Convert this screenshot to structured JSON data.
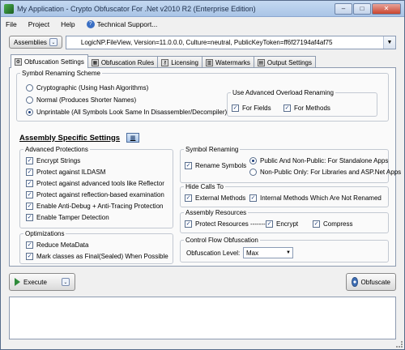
{
  "window": {
    "title": "My Application - Crypto Obfuscator For .Net v2010 R2 (Enterprise Edition)",
    "min": "–",
    "max": "□",
    "close": "✕"
  },
  "menu": {
    "file": "File",
    "project": "Project",
    "help": "Help",
    "support": "Technical Support..."
  },
  "assemblies": {
    "button_label": "Assemblies",
    "selected": "LogicNP.FileView, Version=11.0.0.0, Culture=neutral, PublicKeyToken=ff6f27194af4af75"
  },
  "tabs": [
    {
      "label": "Obfuscation Settings",
      "active": true
    },
    {
      "label": "Obfuscation Rules",
      "active": false
    },
    {
      "label": "Licensing",
      "active": false
    },
    {
      "label": "Watermarks",
      "active": false
    },
    {
      "label": "Output Settings",
      "active": false
    }
  ],
  "symbol_renaming_scheme": {
    "title": "Symbol Renaming Scheme",
    "options": [
      {
        "label": "Cryptographic (Using Hash Algorithms)",
        "checked": false
      },
      {
        "label": "Normal (Produces Shorter Names)",
        "checked": false
      },
      {
        "label": "Unprintable  (All Symbols Look Same In Disassembler/Decompiler)",
        "checked": true
      }
    ],
    "overload": {
      "title": "Use Advanced Overload Renaming",
      "for_fields": "For Fields",
      "for_methods": "For Methods"
    }
  },
  "assembly_specific": {
    "title": "Assembly Specific Settings"
  },
  "advanced_protections": {
    "title": "Advanced Protections",
    "items": [
      "Encrypt Strings",
      "Protect against ILDASM",
      "Protect against advanced tools like Reflector",
      "Protect against reflection-based examination",
      "Enable Anti-Debug + Anti-Tracing Protection",
      "Enable Tamper Detection"
    ]
  },
  "optimizations": {
    "title": "Optimizations",
    "items": [
      "Reduce MetaData",
      "Mark classes as Final(Sealed) When Possible"
    ]
  },
  "symbol_renaming": {
    "title": "Symbol Renaming",
    "rename": "Rename Symbols",
    "public": "Public And Non-Public: For Standalone Apps",
    "nonpublic": "Non-Public Only: For Libraries and ASP.Net Apps"
  },
  "hide_calls": {
    "title": "Hide Calls To",
    "external": "External Methods",
    "internal": "Internal Methods Which Are Not Renamed"
  },
  "assembly_resources": {
    "title": "Assembly Resources",
    "protect": "Protect Resources --------",
    "encrypt": "Encrypt",
    "compress": "Compress"
  },
  "control_flow": {
    "title": "Control Flow Obfuscation",
    "level_label": "Obfuscation Level:",
    "level_value": "Max"
  },
  "actions": {
    "execute": "Execute",
    "obfuscate": "Obfuscate"
  },
  "check": "✓"
}
